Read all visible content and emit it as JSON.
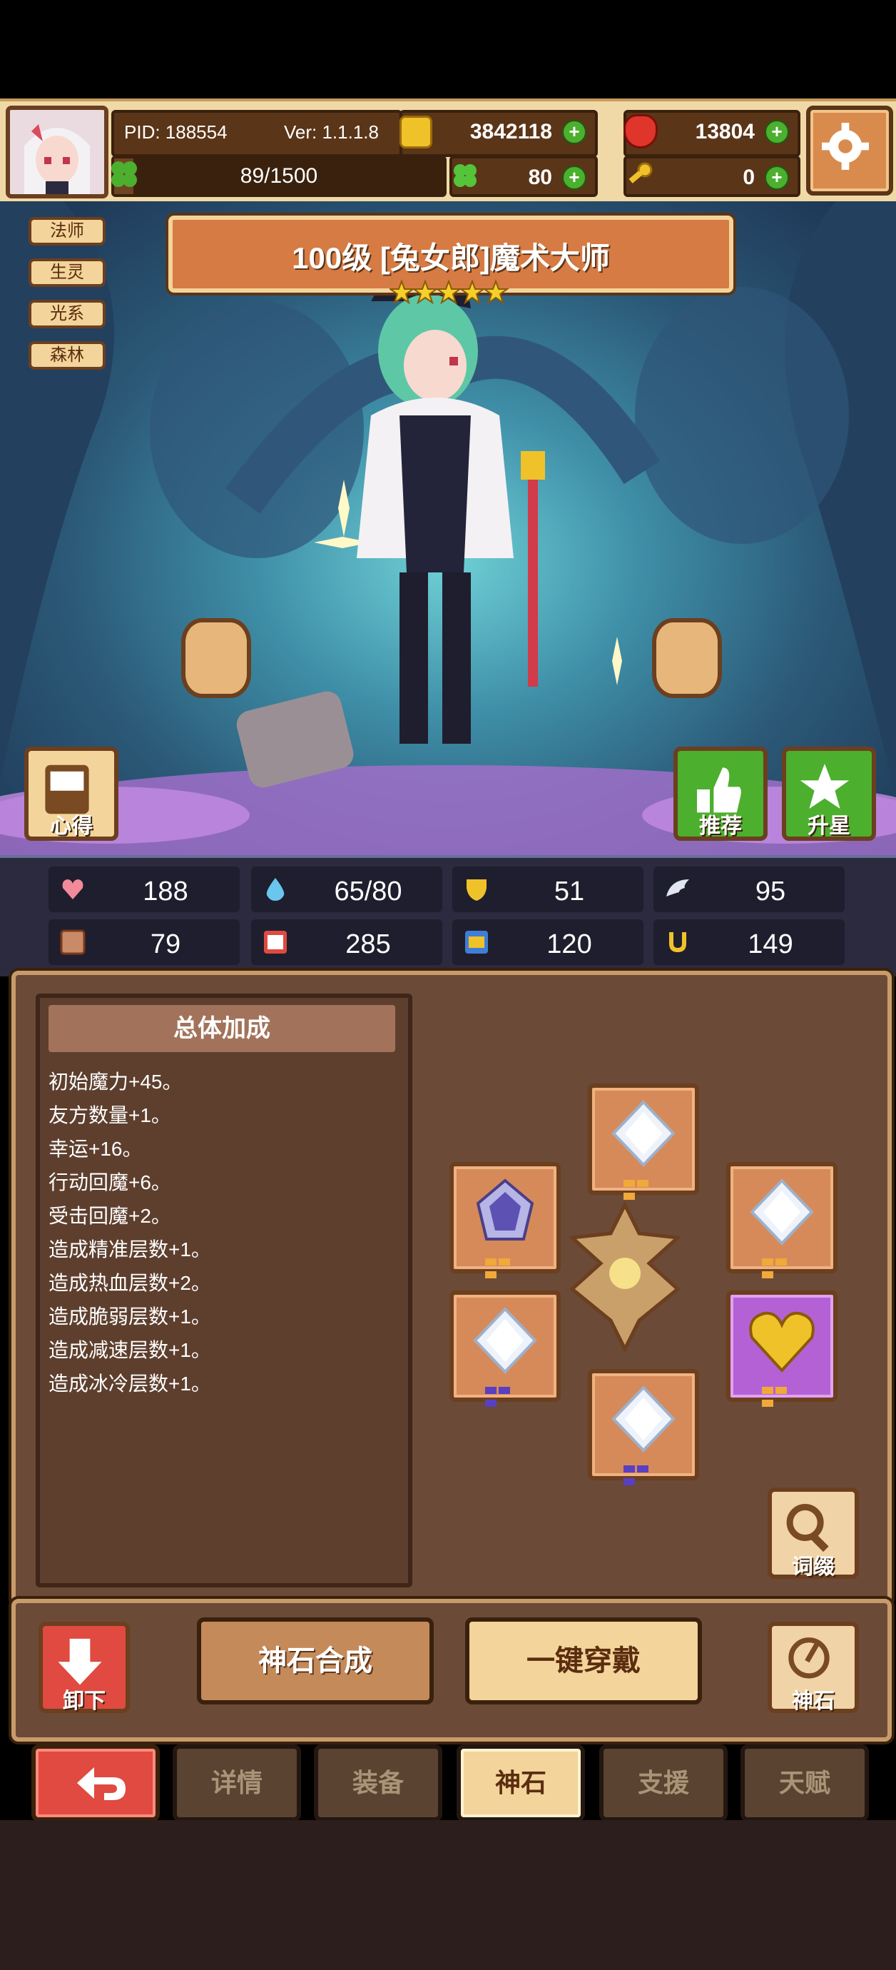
{
  "header": {
    "pid_label": "PID: 188554",
    "version_label": "Ver: 1.1.1.8",
    "gold": "3842118",
    "gems": "13804",
    "xp_text": "89/1500",
    "xp_fraction": 0.0593,
    "clovers": "80",
    "keys": "0"
  },
  "character": {
    "tags": [
      "法师",
      "生灵",
      "光系",
      "森林"
    ],
    "title": "100级 [兔女郎]魔术大师",
    "stars": 5,
    "buttons": {
      "notes": "心得",
      "recommend": "推荐",
      "star_up": "升星"
    }
  },
  "stats": [
    {
      "icon": "heart-icon",
      "value": "188"
    },
    {
      "icon": "water-drop-icon",
      "value": "65/80"
    },
    {
      "icon": "shield-icon",
      "value": "51"
    },
    {
      "icon": "wing-icon",
      "value": "95"
    },
    {
      "icon": "fist-icon",
      "value": "79"
    },
    {
      "icon": "spellbook-icon",
      "value": "285"
    },
    {
      "icon": "scroll-icon",
      "value": "120"
    },
    {
      "icon": "horseshoe-icon",
      "value": "149"
    }
  ],
  "bonus": {
    "header": "总体加成",
    "lines": [
      "初始魔力+45。",
      "友方数量+1。",
      "幸运+16。",
      "行动回魔+6。",
      "受击回魔+2。",
      "造成精准层数+1。",
      "造成热血层数+2。",
      "造成脆弱层数+1。",
      "造成减速层数+1。",
      "造成冰冷层数+1。"
    ]
  },
  "gems_panel": {
    "affix_label": "词缀"
  },
  "actions": {
    "unequip": "卸下",
    "synthesize": "神石合成",
    "equip_all": "一键穿戴",
    "divine_stone": "神石"
  },
  "tabs": [
    "详情",
    "装备",
    "神石",
    "支援",
    "天赋"
  ],
  "active_tab": "神石",
  "colors": {
    "accent": "#d67b43",
    "panel": "#6b4a37",
    "tab_active": "#f3d49a",
    "back_button": "#e04a40"
  }
}
